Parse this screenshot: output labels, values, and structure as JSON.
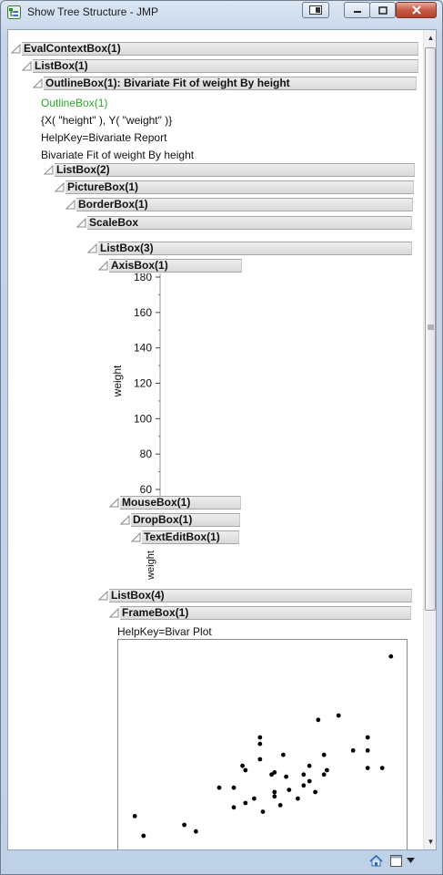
{
  "window": {
    "title": "Show Tree Structure - JMP"
  },
  "tree": {
    "eval_context": "EvalContextBox(1)",
    "listbox1": "ListBox(1)",
    "outline": "OutlineBox(1): Bivariate Fit of weight By height",
    "outline_id": "OutlineBox(1)",
    "xy_spec": "{X( \"height\" ), Y( \"weight\" )}",
    "helpkey1": "HelpKey=Bivariate Report",
    "report_title": "Bivariate Fit of weight By height",
    "listbox2": "ListBox(2)",
    "picturebox": "PictureBox(1)",
    "borderbox": "BorderBox(1)",
    "scalebox": "ScaleBox",
    "listbox3": "ListBox(3)",
    "axisbox": "AxisBox(1)",
    "mousebox": "MouseBox(1)",
    "dropbox": "DropBox(1)",
    "texteditbox": "TextEditBox(1)",
    "texteditbox_text": "weight",
    "listbox4": "ListBox(4)",
    "framebox": "FrameBox(1)",
    "helpkey2": "HelpKey=Bivar Plot"
  },
  "axis": {
    "label": "weight",
    "ticks": [
      "180",
      "160",
      "140",
      "120",
      "100",
      "80",
      "60"
    ]
  },
  "chart_data": {
    "type": "scatter",
    "title": "",
    "ylabel": "weight",
    "ylim": [
      60,
      180
    ],
    "points": [
      {
        "x": 0.06,
        "y": 0.81
      },
      {
        "x": 0.09,
        "y": 0.9
      },
      {
        "x": 0.23,
        "y": 0.85
      },
      {
        "x": 0.27,
        "y": 0.88
      },
      {
        "x": 0.35,
        "y": 0.68
      },
      {
        "x": 0.4,
        "y": 0.77
      },
      {
        "x": 0.4,
        "y": 0.68
      },
      {
        "x": 0.43,
        "y": 0.58
      },
      {
        "x": 0.44,
        "y": 0.6
      },
      {
        "x": 0.44,
        "y": 0.75
      },
      {
        "x": 0.47,
        "y": 0.73
      },
      {
        "x": 0.49,
        "y": 0.45
      },
      {
        "x": 0.49,
        "y": 0.48
      },
      {
        "x": 0.49,
        "y": 0.55
      },
      {
        "x": 0.5,
        "y": 0.79
      },
      {
        "x": 0.53,
        "y": 0.62
      },
      {
        "x": 0.54,
        "y": 0.72
      },
      {
        "x": 0.54,
        "y": 0.7
      },
      {
        "x": 0.54,
        "y": 0.61
      },
      {
        "x": 0.56,
        "y": 0.76
      },
      {
        "x": 0.57,
        "y": 0.53
      },
      {
        "x": 0.58,
        "y": 0.63
      },
      {
        "x": 0.59,
        "y": 0.69
      },
      {
        "x": 0.62,
        "y": 0.73
      },
      {
        "x": 0.64,
        "y": 0.62
      },
      {
        "x": 0.64,
        "y": 0.67
      },
      {
        "x": 0.66,
        "y": 0.58
      },
      {
        "x": 0.66,
        "y": 0.65
      },
      {
        "x": 0.68,
        "y": 0.7
      },
      {
        "x": 0.71,
        "y": 0.62
      },
      {
        "x": 0.72,
        "y": 0.6
      },
      {
        "x": 0.71,
        "y": 0.53
      },
      {
        "x": 0.69,
        "y": 0.37
      },
      {
        "x": 0.76,
        "y": 0.35
      },
      {
        "x": 0.81,
        "y": 0.51
      },
      {
        "x": 0.86,
        "y": 0.51
      },
      {
        "x": 0.86,
        "y": 0.59
      },
      {
        "x": 0.86,
        "y": 0.45
      },
      {
        "x": 0.91,
        "y": 0.59
      },
      {
        "x": 0.94,
        "y": 0.08
      }
    ]
  },
  "statusbar": {
    "icons": [
      "home-icon",
      "window-icon",
      "dropdown-arrow-icon"
    ]
  },
  "colors": {
    "outline_green": "#27a927",
    "header_bg": "#e4e4e4",
    "close_red": "#c75a44"
  }
}
